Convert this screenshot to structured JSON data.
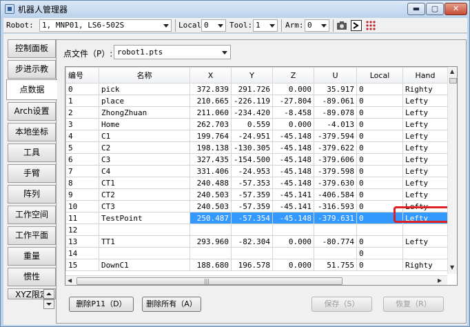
{
  "window": {
    "title": "机器人管理器"
  },
  "window_controls": {
    "minimize": "▬",
    "maximize": "▢",
    "close": "✕"
  },
  "toolbar": {
    "robot_label": "Robot:",
    "robot_value": "1, MNP01, LS6-502S",
    "local_label": "Local",
    "local_value": "0",
    "tool_label": "Tool:",
    "tool_value": "1",
    "arm_label": "Arm:",
    "arm_value": "0"
  },
  "tabs": [
    {
      "label": "控制面板"
    },
    {
      "label": "步进示教"
    },
    {
      "label": "点数据",
      "active": true
    },
    {
      "label": "Arch设置"
    },
    {
      "label": "本地坐标"
    },
    {
      "label": "工具"
    },
    {
      "label": "手臂"
    },
    {
      "label": "阵列"
    },
    {
      "label": "工作空间"
    },
    {
      "label": "工作平面"
    },
    {
      "label": "重量"
    },
    {
      "label": "惯性"
    },
    {
      "label": "XYZ限定"
    }
  ],
  "point_file": {
    "label": "点文件（P）:",
    "value": "robot1.pts"
  },
  "table": {
    "columns": [
      "编号",
      "名称",
      "X",
      "Y",
      "Z",
      "U",
      "Local",
      "Hand"
    ],
    "rows": [
      [
        "0",
        "pick",
        "372.839",
        "291.726",
        "0.000",
        "35.917",
        "0",
        "Righty"
      ],
      [
        "1",
        "place",
        "210.665",
        "-226.119",
        "-27.804",
        "-89.061",
        "0",
        "Lefty"
      ],
      [
        "2",
        "ZhongZhuan",
        "211.060",
        "-234.420",
        "-8.458",
        "-89.078",
        "0",
        "Lefty"
      ],
      [
        "3",
        "Home",
        "262.703",
        "0.559",
        "0.000",
        "-4.013",
        "0",
        "Lefty"
      ],
      [
        "4",
        "C1",
        "199.764",
        "-24.951",
        "-45.148",
        "-379.594",
        "0",
        "Lefty"
      ],
      [
        "5",
        "C2",
        "198.138",
        "-130.305",
        "-45.148",
        "-379.622",
        "0",
        "Lefty"
      ],
      [
        "6",
        "C3",
        "327.435",
        "-154.500",
        "-45.148",
        "-379.606",
        "0",
        "Lefty"
      ],
      [
        "7",
        "C4",
        "331.406",
        "-24.953",
        "-45.148",
        "-379.598",
        "0",
        "Lefty"
      ],
      [
        "8",
        "CT1",
        "240.488",
        "-57.353",
        "-45.148",
        "-379.630",
        "0",
        "Lefty"
      ],
      [
        "9",
        "CT2",
        "240.503",
        "-57.359",
        "-45.141",
        "-406.584",
        "0",
        "Lefty"
      ],
      [
        "10",
        "CT3",
        "240.503",
        "-57.359",
        "-45.141",
        "-316.593",
        "0",
        "Lefty"
      ],
      [
        "11",
        "TestPoint",
        "250.487",
        "-57.354",
        "-45.148",
        "-379.631",
        "0",
        "Lefty"
      ],
      [
        "12",
        "",
        "",
        "",
        "",
        "",
        "",
        ""
      ],
      [
        "13",
        "TT1",
        "293.960",
        "-82.304",
        "0.000",
        "-80.774",
        "0",
        "Lefty"
      ],
      [
        "14",
        "",
        "",
        "",
        "",
        "",
        "0",
        ""
      ],
      [
        "15",
        "DownC1",
        "188.680",
        "196.578",
        "0.000",
        "51.755",
        "0",
        "Righty"
      ]
    ],
    "selected_row": 11
  },
  "scroll_arrows": {
    "up": "▲",
    "down": "▼",
    "left": "◀",
    "right": "▶",
    "grip": "|||"
  },
  "buttons": {
    "delete": "删除P11（D）",
    "delete_all": "删除所有（A）",
    "save": "保存（S）",
    "restore": "恢复（R）"
  }
}
